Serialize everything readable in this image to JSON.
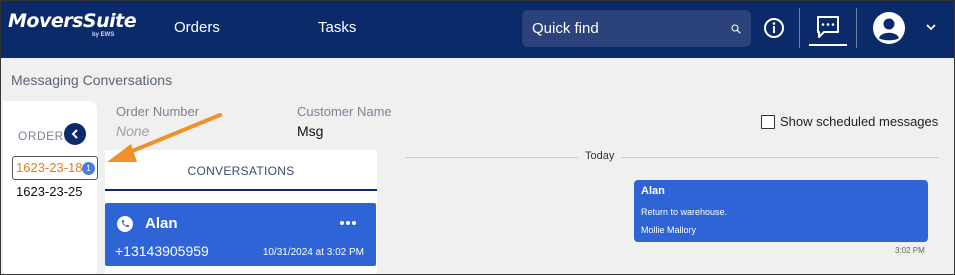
{
  "brand": {
    "name": "MoversSuite",
    "sub": "by EWS"
  },
  "nav": {
    "orders": "Orders",
    "tasks": "Tasks"
  },
  "search": {
    "placeholder": "Quick find"
  },
  "page": {
    "title": "Messaging Conversations"
  },
  "sidebar": {
    "label": "ORDERS",
    "orders": [
      {
        "number": "1623-23-18",
        "badge": "1",
        "active": true
      },
      {
        "number": "1623-23-25"
      }
    ]
  },
  "header": {
    "order_number_label": "Order Number",
    "order_number_value": "None",
    "customer_name_label": "Customer Name",
    "customer_name_value": "Msg",
    "show_scheduled_label": "Show scheduled messages"
  },
  "conversations": {
    "tab_label": "CONVERSATIONS",
    "items": [
      {
        "name": "Alan",
        "phone": "+13143905959",
        "timestamp": "10/31/2024 at 3:02 PM"
      }
    ]
  },
  "messages": {
    "day_separator": "Today",
    "items": [
      {
        "sender": "Alan",
        "text": "Return to warehouse.",
        "author": "Mollie Mallory",
        "time": "3:02 PM"
      }
    ]
  },
  "colors": {
    "nav_bg": "#0b2a6a",
    "accent_blue": "#2e64d6",
    "active_order": "#e07f1c",
    "annotation_arrow": "#f0902a"
  }
}
